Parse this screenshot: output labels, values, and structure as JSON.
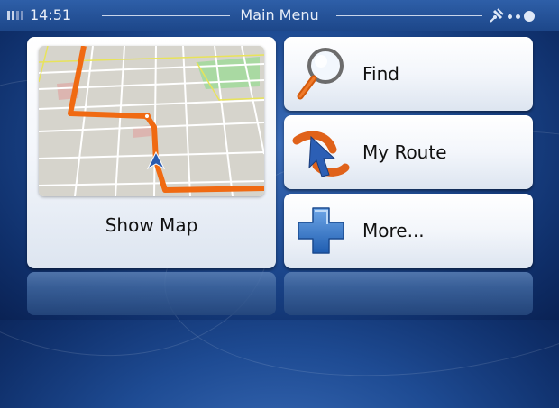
{
  "status_bar": {
    "time": "14:51",
    "title": "Main Menu",
    "icons": [
      "signal-strength-icon",
      "satellite-icon",
      "page-indicator-icon"
    ]
  },
  "menu": {
    "show_map": {
      "label": "Show Map",
      "icon": "map-preview"
    },
    "find": {
      "label": "Find",
      "icon": "magnifier-icon"
    },
    "my_route": {
      "label": "My Route",
      "icon": "route-arrow-icon"
    },
    "more": {
      "label": "More...",
      "icon": "plus-icon"
    }
  },
  "colors": {
    "background": "#1e4b93",
    "route": "#f06a12",
    "button_face": "#f3f6fb"
  }
}
